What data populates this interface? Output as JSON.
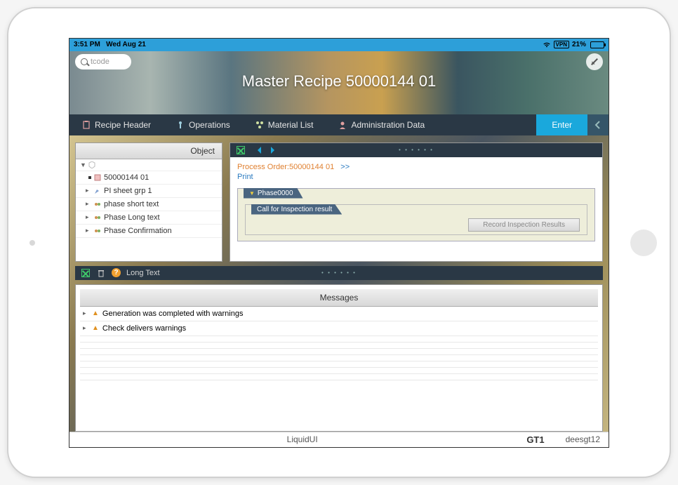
{
  "status": {
    "time": "3:51 PM",
    "date": "Wed Aug 21",
    "vpn": "VPN",
    "battery_pct": "21%"
  },
  "search": {
    "placeholder": "tcode"
  },
  "banner": {
    "title": "Master Recipe 50000144 01"
  },
  "tabs": [
    {
      "label": "Recipe Header"
    },
    {
      "label": "Operations"
    },
    {
      "label": "Material List"
    },
    {
      "label": "Administration Data"
    }
  ],
  "enter_label": "Enter",
  "tree": {
    "header": "Object",
    "items": [
      {
        "label": "50000144 01"
      },
      {
        "label": "PI sheet grp 1"
      },
      {
        "label": "phase short text"
      },
      {
        "label": "Phase Long text"
      },
      {
        "label": "Phase Confirmation"
      }
    ]
  },
  "detail": {
    "process_order": "Process Order:50000144 01",
    "arrows": ">>",
    "print": "Print",
    "phase_tab": "Phase0000",
    "call_tab": "Call for Inspection result",
    "record_btn": "Record Inspection Results"
  },
  "msgbar": {
    "long_text": "Long Text"
  },
  "messages": {
    "header": "Messages",
    "rows": [
      "Generation was completed with warnings",
      "Check delivers warnings"
    ]
  },
  "footer": {
    "brand": "LiquidUI",
    "sys": "GT1",
    "user": "deesgt12"
  }
}
